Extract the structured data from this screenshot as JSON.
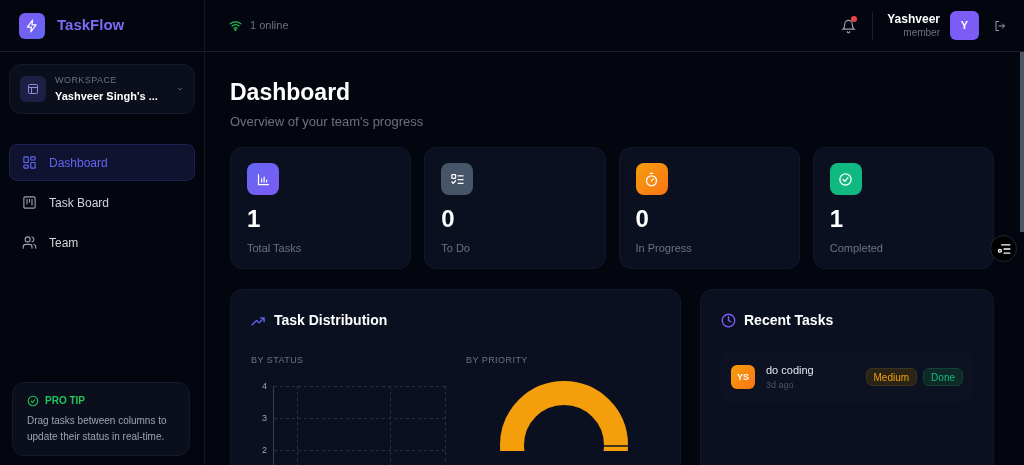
{
  "brand": {
    "name": "TaskFlow"
  },
  "header": {
    "online": "1 online",
    "notification": {
      "unread": true
    },
    "user": {
      "name": "Yashveer",
      "role": "member",
      "initial": "Y"
    }
  },
  "workspace": {
    "label": "WORKSPACE",
    "name": "Yashveer Singh's ..."
  },
  "nav": [
    {
      "kind": "dashboard",
      "label": "Dashboard",
      "selected": true
    },
    {
      "kind": "board",
      "label": "Task Board",
      "selected": false
    },
    {
      "kind": "team",
      "label": "Team",
      "selected": false
    }
  ],
  "pro_tip": {
    "title": "PRO TIP",
    "text": "Drag tasks between columns to update their status in real-time."
  },
  "page": {
    "title": "Dashboard",
    "subtitle": "Overview of your team's progress"
  },
  "stats": [
    {
      "kind": "total",
      "value": "1",
      "label": "Total Tasks"
    },
    {
      "kind": "todo",
      "value": "0",
      "label": "To Do"
    },
    {
      "kind": "progress",
      "value": "0",
      "label": "In Progress"
    },
    {
      "kind": "done",
      "value": "1",
      "label": "Completed"
    }
  ],
  "distribution": {
    "title": "Task Distribution",
    "by_status": {
      "label": "BY STATUS",
      "y_ticks": [
        "4",
        "3",
        "2"
      ]
    },
    "by_priority": {
      "label": "BY PRIORITY"
    }
  },
  "recent": {
    "title": "Recent Tasks",
    "tasks": [
      {
        "initials": "YS",
        "title": "do coding",
        "time": "3d ago",
        "priority": {
          "kind": "medium",
          "label": "Medium"
        },
        "status": {
          "kind": "done",
          "label": "Done"
        }
      }
    ]
  }
}
